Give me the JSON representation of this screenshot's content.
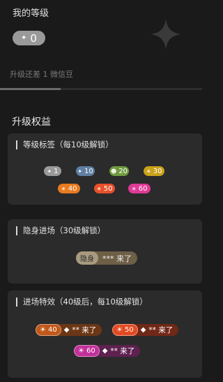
{
  "header": {
    "title": "我的等级",
    "level_value": "0",
    "level_icon": "sparkle-icon"
  },
  "progress": {
    "text": "升级还差 1 微信豆",
    "fraction": 0.3
  },
  "benefits": {
    "title": "升级权益",
    "level_tags": {
      "title": "等级标签（每10级解锁）",
      "tags": [
        {
          "value": "1",
          "color": "#9a9a9a"
        },
        {
          "value": "10",
          "color": "#5f7fa3"
        },
        {
          "value": "20",
          "color": "#6f9a3e"
        },
        {
          "value": "30",
          "color": "#c9a21a"
        },
        {
          "value": "40",
          "color": "#e87a1f"
        },
        {
          "value": "50",
          "color": "#e8502a"
        },
        {
          "value": "60",
          "color": "#e03a97"
        }
      ]
    },
    "stealth": {
      "title": "隐身进场（30级解锁）",
      "badge": "隐身",
      "text": "*** 来了"
    },
    "effects": {
      "title": "进场特效（40级后，每10级解锁）",
      "items": [
        {
          "level": "40",
          "text": "** 来了",
          "color": "#c1581a",
          "bg": "#6b3716"
        },
        {
          "level": "50",
          "text": "** 来了",
          "color": "#e34a22",
          "bg": "#702817"
        },
        {
          "level": "60",
          "text": "** 来了",
          "color": "#c2309a",
          "bg": "#5e2150"
        }
      ]
    }
  }
}
